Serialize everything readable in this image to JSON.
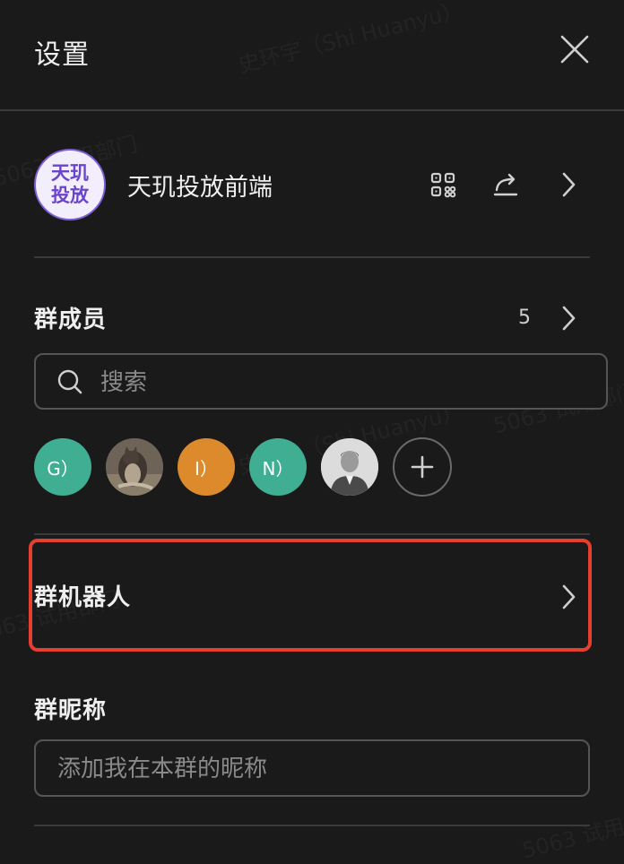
{
  "header": {
    "title": "设置",
    "close_icon": "close-icon"
  },
  "group": {
    "avatar_text": "天玑投放",
    "name": "天玑投放前端",
    "actions": [
      "qrcode-icon",
      "share-icon",
      "chevron-right-icon"
    ]
  },
  "members": {
    "title": "群成员",
    "count": "5",
    "search_placeholder": "搜索",
    "list": [
      {
        "label": "G）",
        "color": "#3fae93"
      },
      {
        "label": "",
        "color": "#5a5048"
      },
      {
        "label": "I）",
        "color": "#dc8a2c"
      },
      {
        "label": "N）",
        "color": "#3fae93"
      },
      {
        "label": "",
        "color": "#cfcfcf"
      }
    ],
    "add_icon": "plus-icon"
  },
  "bot": {
    "title": "群机器人"
  },
  "nickname": {
    "title": "群昵称",
    "placeholder": "添加我在本群的昵称"
  },
  "watermark": {
    "name": "史环宇（Shi Huanyu）",
    "number": "5063 试用部门"
  },
  "colors": {
    "background": "#1a1a1a",
    "highlight_border": "#e5402f",
    "avatar_accent": "#7c5fd6"
  }
}
